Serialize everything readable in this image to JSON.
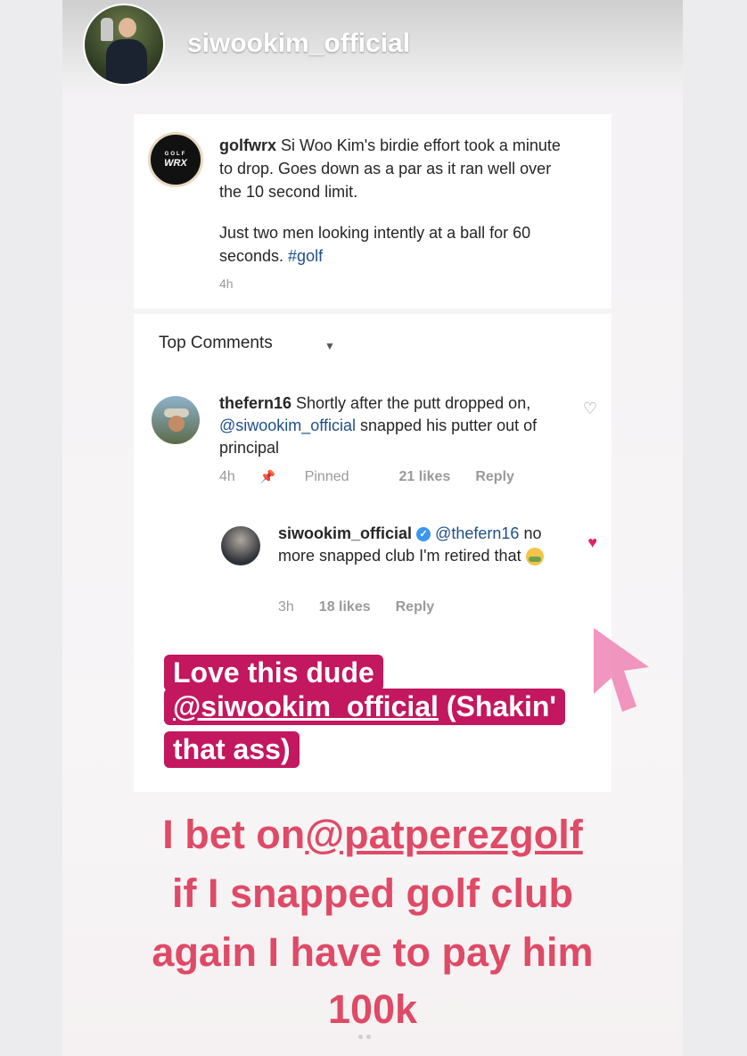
{
  "story": {
    "username": "siwookim_official",
    "avatar_icon": "profile-photo"
  },
  "post": {
    "username": "golfwrx",
    "brand_small": "GOLF",
    "brand_big": "WRX",
    "text_1": "Si Woo Kim's birdie effort took a minute to drop. Goes down as a par as it ran well over the 10 second limit.",
    "text_2": "Just two men looking intently at a ball for 60 seconds. ",
    "hashtag": "#golf",
    "time": "4h"
  },
  "top_comments": {
    "label": "Top Comments",
    "caret": "▼"
  },
  "comment_1": {
    "username": "thefern16",
    "text_pre": " Shortly after the putt dropped on, ",
    "mention": "@siwookim_official",
    "text_post": " snapped his putter out of principal",
    "time": "4h",
    "pinned_icon": "📌",
    "pinned": "Pinned",
    "likes": "21 likes",
    "reply": "Reply"
  },
  "comment_2": {
    "username": "siwookim_official",
    "verified": "✓",
    "mention": "@thefern16",
    "text": "no more snapped club I'm retired that",
    "time": "3h",
    "likes": "18 likes",
    "reply": "Reply"
  },
  "sticker": {
    "line_1": "Love this dude",
    "line_2_mention": "@siwookim_official",
    "line_2_rest": " (Shakin'",
    "line_3": "that ass)"
  },
  "caption": {
    "line_1_pre": "I bet on",
    "line_1_mention": "@patperezgolf",
    "line_2": "if I snapped golf club",
    "line_3": "again I have to pay him",
    "line_4": "100k"
  },
  "colors": {
    "sticker_bg": "#c3175f",
    "caption_text": "#df4a66",
    "heart_liked": "#e0245e",
    "verified": "#3897f0",
    "cursor": "#f08bb8"
  }
}
